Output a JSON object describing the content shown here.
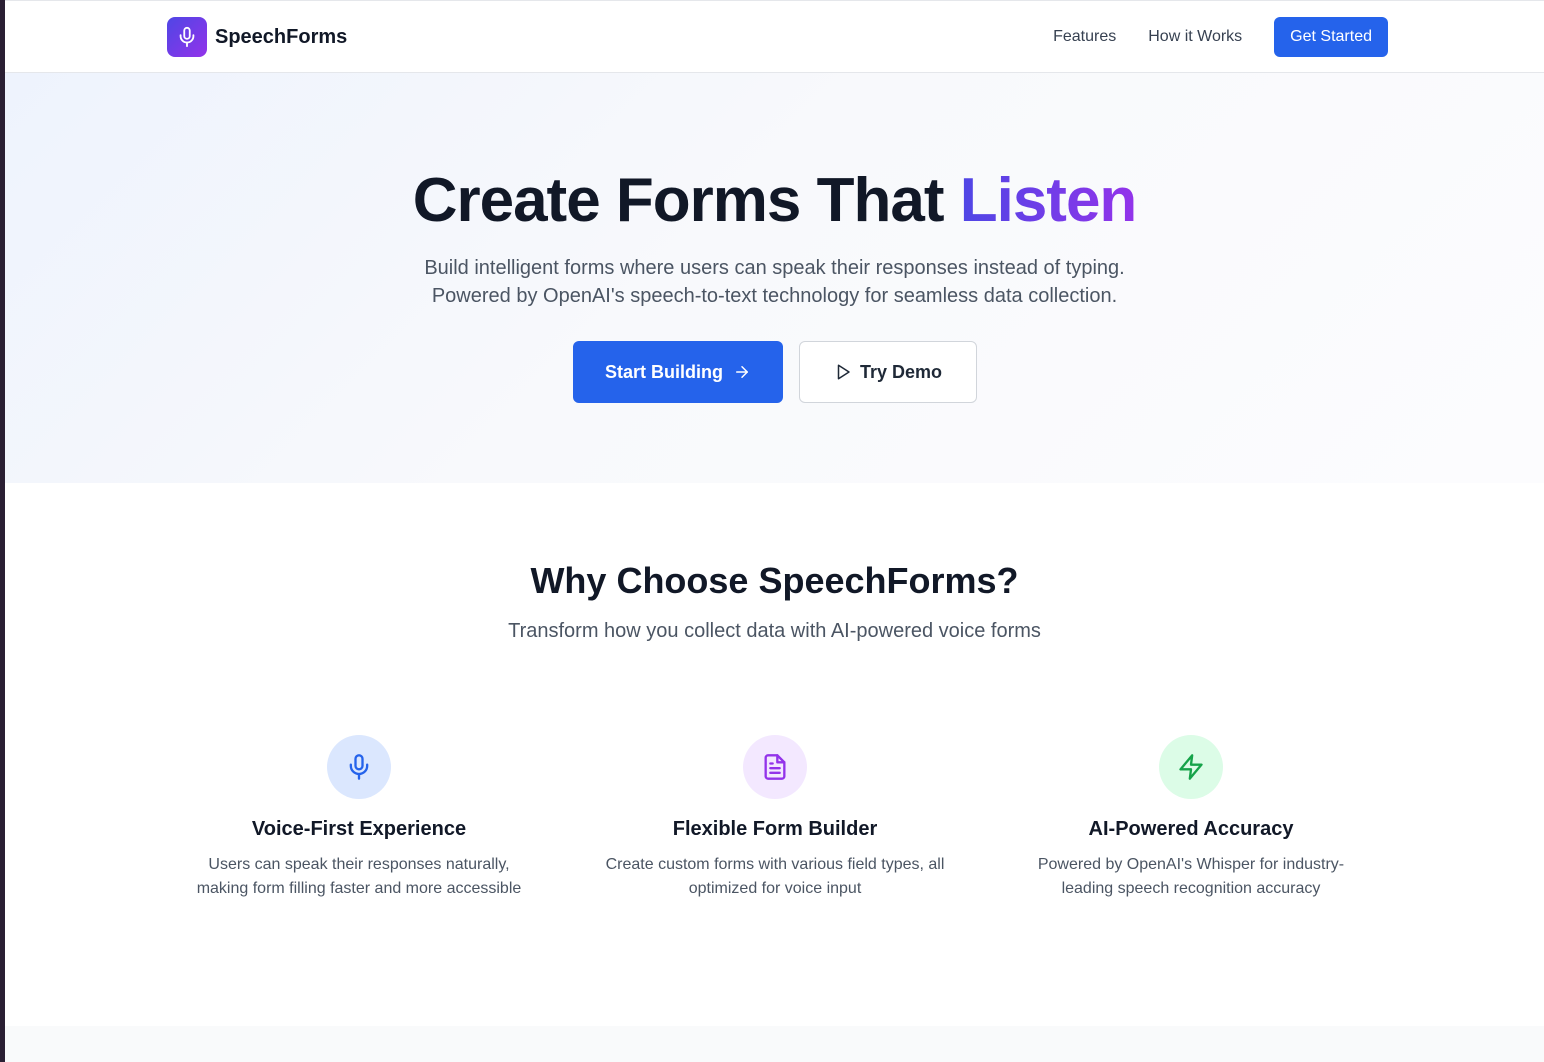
{
  "header": {
    "brand": "SpeechForms",
    "brand_icon": "microphone-icon",
    "nav": [
      "Features",
      "How it Works"
    ],
    "cta": "Get Started"
  },
  "hero": {
    "title_main": "Create Forms That ",
    "title_accent": "Listen",
    "subtitle_line1": "Build intelligent forms where users can speak their responses instead of typing.",
    "subtitle_line2": "Powered by OpenAI's speech-to-text technology for seamless data collection.",
    "primary_button": "Start Building",
    "primary_icon": "arrow-right-icon",
    "secondary_button": "Try Demo",
    "secondary_icon": "play-icon"
  },
  "features": {
    "title": "Why Choose SpeechForms?",
    "subtitle": "Transform how you collect data with AI-powered voice forms",
    "items": [
      {
        "title": "Voice-First Experience",
        "description": "Users can speak their responses naturally, making form filling faster and more accessible",
        "icon": "microphone-icon",
        "icon_color": "#2563eb",
        "icon_bg": "#dbe7fe"
      },
      {
        "title": "Flexible Form Builder",
        "description": "Create custom forms with various field types, all optimized for voice input",
        "icon": "document-icon",
        "icon_color": "#9333ea",
        "icon_bg": "#f3e8ff"
      },
      {
        "title": "AI-Powered Accuracy",
        "description": "Powered by OpenAI's Whisper for industry-leading speech recognition accuracy",
        "icon": "lightning-icon",
        "icon_color": "#16a34a",
        "icon_bg": "#dcfce7"
      }
    ]
  },
  "colors": {
    "primary": "#2563eb",
    "accent_gradient_start": "#4f46e5",
    "accent_gradient_end": "#9333ea",
    "text_dark": "#111827",
    "text_muted": "#4b5563"
  }
}
